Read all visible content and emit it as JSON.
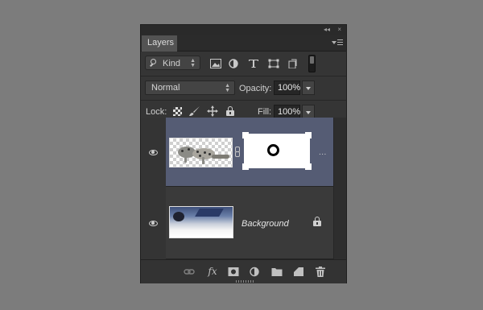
{
  "panel": {
    "tab_label": "Layers",
    "collapse_glyph": "◂◂",
    "close_glyph": "×"
  },
  "filter": {
    "kind_label": "Kind",
    "icons": [
      "image-filter-icon",
      "adjustment-filter-icon",
      "type-filter-icon",
      "shape-filter-icon",
      "smart-object-filter-icon",
      "filter-toggle-switch"
    ]
  },
  "blend": {
    "mode": "Normal",
    "opacity_label": "Opacity:",
    "opacity_value": "100%"
  },
  "lock": {
    "label": "Lock:",
    "fill_label": "Fill:",
    "fill_value": "100%",
    "icons": [
      "lock-transparent-pixels-icon",
      "lock-image-pixels-icon",
      "lock-position-icon",
      "lock-all-icon"
    ]
  },
  "layers": [
    {
      "name": "",
      "selected": true,
      "has_mask": true,
      "visible": true,
      "more": "..."
    },
    {
      "name": "Background",
      "selected": false,
      "locked": true,
      "visible": true
    }
  ],
  "footer": {
    "fx_label": "fx",
    "buttons": [
      "link-layers-icon",
      "fx-icon",
      "add-mask-icon",
      "adjustment-layer-icon",
      "group-folder-icon",
      "new-layer-icon",
      "trash-icon"
    ]
  },
  "colors": {
    "selected_layer": "#555c74",
    "panel_bg": "#353535",
    "canvas_bg": "#7c7c7c"
  }
}
